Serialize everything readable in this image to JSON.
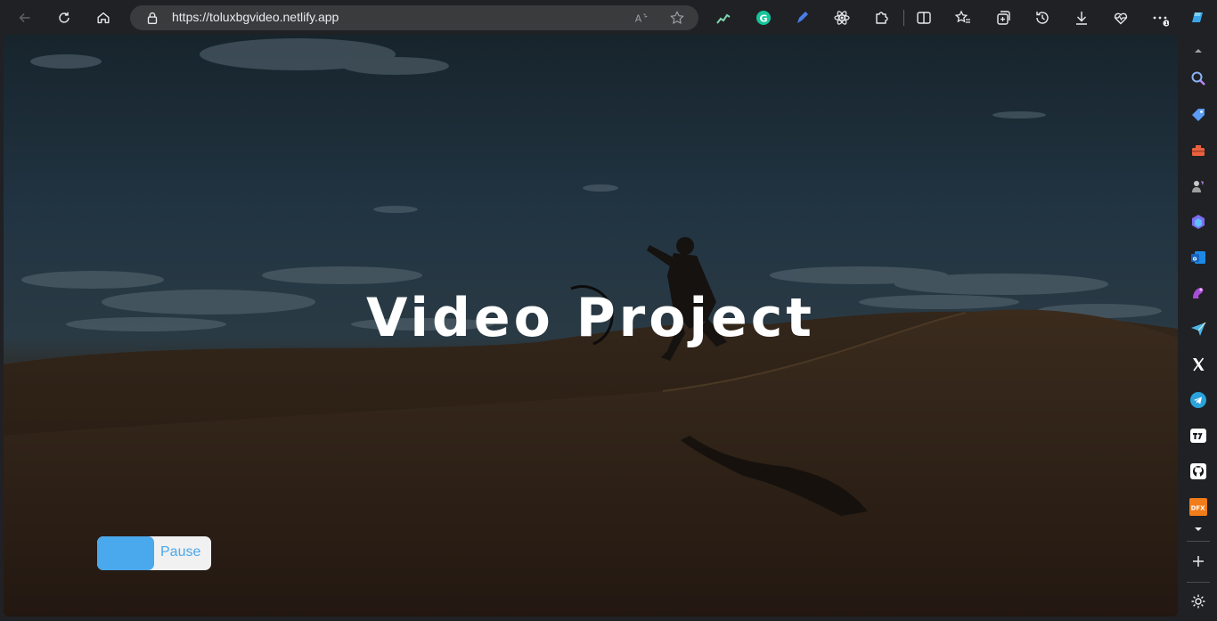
{
  "browser": {
    "url": "https://toluxbgvideo.netlify.app",
    "downloads_badge": "1"
  },
  "page": {
    "hero_title": "Video Project",
    "toggle_label": "Pause"
  },
  "sidebar": {
    "items": [
      {
        "name": "search-icon",
        "color": "#8ab4f8"
      },
      {
        "name": "shopping-tag-icon",
        "color": "#5b9cf5"
      },
      {
        "name": "tools-icon",
        "color": "#e8613f"
      },
      {
        "name": "games-icon",
        "color": "#b9b9b9"
      },
      {
        "name": "copilot-icon",
        "color": "#7b6cf0"
      },
      {
        "name": "outlook-icon",
        "color": "#1976d2"
      },
      {
        "name": "designer-icon",
        "color": "#a64ed6"
      },
      {
        "name": "send-icon",
        "color": "#4fb4e8"
      },
      {
        "name": "x-icon",
        "color": "#ffffff"
      },
      {
        "name": "telegram-icon",
        "color": "#2aa3dc"
      },
      {
        "name": "tradingview-icon",
        "color": "#ffffff"
      },
      {
        "name": "github-icon",
        "color": "#ffffff"
      },
      {
        "name": "dfx-icon",
        "color": "#f07c1a",
        "label": "DFX"
      }
    ]
  },
  "colors": {
    "toolbar_bg": "#202124",
    "accent_blue": "#4aa8ec",
    "toggle_bg": "#f1f1f1"
  }
}
